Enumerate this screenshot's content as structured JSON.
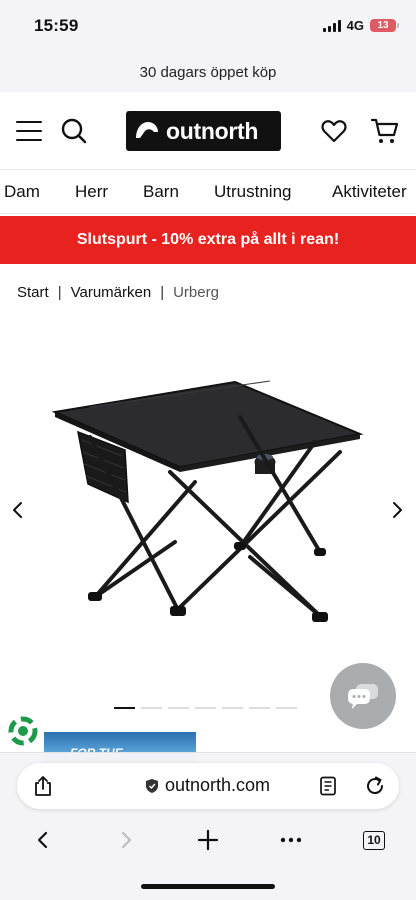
{
  "status_bar": {
    "time": "15:59",
    "network": "4G",
    "battery": "13",
    "battery_color": "#e05a63"
  },
  "promo": {
    "text": "30 dagars öppet köp"
  },
  "header": {
    "logo_text": "outnorth",
    "icons": [
      "menu-icon",
      "search-icon",
      "heart-icon",
      "cart-icon"
    ]
  },
  "nav": {
    "items": [
      "Dam",
      "Herr",
      "Barn",
      "Utrustning",
      "Aktiviteter"
    ]
  },
  "sale_banner": {
    "text": "Slutspurt - 10% extra på allt i rean!",
    "color": "#e8231f"
  },
  "breadcrumb": {
    "items": [
      "Start",
      "Varumärken",
      "Urberg"
    ],
    "separator": "|"
  },
  "gallery": {
    "image": "black folding camping table",
    "slides": 7,
    "active_slide": 1
  },
  "promo_thumb": {
    "text": "FOR THE"
  },
  "browser": {
    "url": "outnorth.com",
    "tab_count": "10"
  }
}
